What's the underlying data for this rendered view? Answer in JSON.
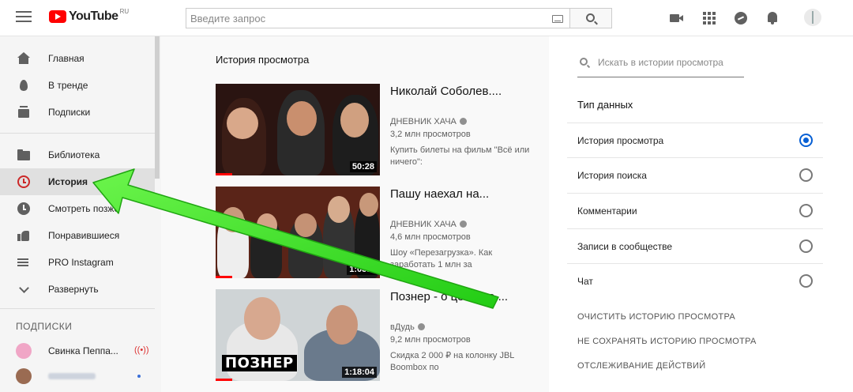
{
  "header": {
    "logo_text": "YouTube",
    "logo_region": "RU",
    "search_placeholder": "Введите запрос",
    "icons": [
      "menu-icon",
      "keyboard-icon",
      "search-icon",
      "create-video-icon",
      "apps-icon",
      "messages-icon",
      "notifications-icon"
    ]
  },
  "sidebar": {
    "items": [
      {
        "label": "Главная",
        "icon": "home-icon"
      },
      {
        "label": "В тренде",
        "icon": "trending-icon"
      },
      {
        "label": "Подписки",
        "icon": "subscriptions-icon"
      },
      {
        "label": "Библиотека",
        "icon": "library-icon"
      },
      {
        "label": "История",
        "icon": "history-icon",
        "active": true
      },
      {
        "label": "Смотреть позже",
        "icon": "watch-later-icon"
      },
      {
        "label": "Понравившиеся",
        "icon": "liked-icon"
      },
      {
        "label": "PRO Instagram",
        "icon": "playlist-icon"
      },
      {
        "label": "Развернуть",
        "icon": "chevron-down-icon"
      }
    ],
    "subscriptions_heading": "ПОДПИСКИ",
    "subscriptions": [
      {
        "name": "Свинка Пеппа...",
        "live": "((•))"
      }
    ]
  },
  "main": {
    "title": "История просмотра",
    "videos": [
      {
        "title": "Николай Соболев....",
        "channel": "ДНЕВНИК ХАЧА",
        "views": "3,2 млн просмотров",
        "description": "Купить билеты на фильм \"Всё или ничего\":",
        "duration": "50:28",
        "watched_fraction": 0.1
      },
      {
        "title": "Пашу наехал на...",
        "channel": "ДНЕВНИК ХАЧА",
        "views": "4,6 млн просмотров",
        "description": "Шоу «Перезагрузка». Как заработать 1 млн за",
        "duration": "1:03:1",
        "watched_fraction": 0.1
      },
      {
        "title": "Познер - о цензуре,...",
        "channel": "вДудь",
        "views": "9,2 млн просмотров",
        "description": "Скидка 2 000 ₽ на колонку JBL Boombox по",
        "duration": "1:18:04",
        "overlay_label": "ПОЗНЕР",
        "watched_fraction": 0.1
      }
    ]
  },
  "panel": {
    "search_placeholder": "Искать в истории просмотра",
    "heading": "Тип данных",
    "options": [
      {
        "label": "История просмотра",
        "selected": true
      },
      {
        "label": "История поиска",
        "selected": false
      },
      {
        "label": "Комментарии",
        "selected": false
      },
      {
        "label": "Записи в сообществе",
        "selected": false
      },
      {
        "label": "Чат",
        "selected": false
      }
    ],
    "actions": [
      "ОЧИСТИТЬ ИСТОРИЮ ПРОСМОТРА",
      "НЕ СОХРАНЯТЬ ИСТОРИЮ ПРОСМОТРА",
      "ОТСЛЕЖИВАНИЕ ДЕЙСТВИЙ"
    ]
  },
  "colors": {
    "brand_red": "#ff0000",
    "accent_blue": "#065fd4",
    "annotation_arrow": "#33e01f"
  }
}
